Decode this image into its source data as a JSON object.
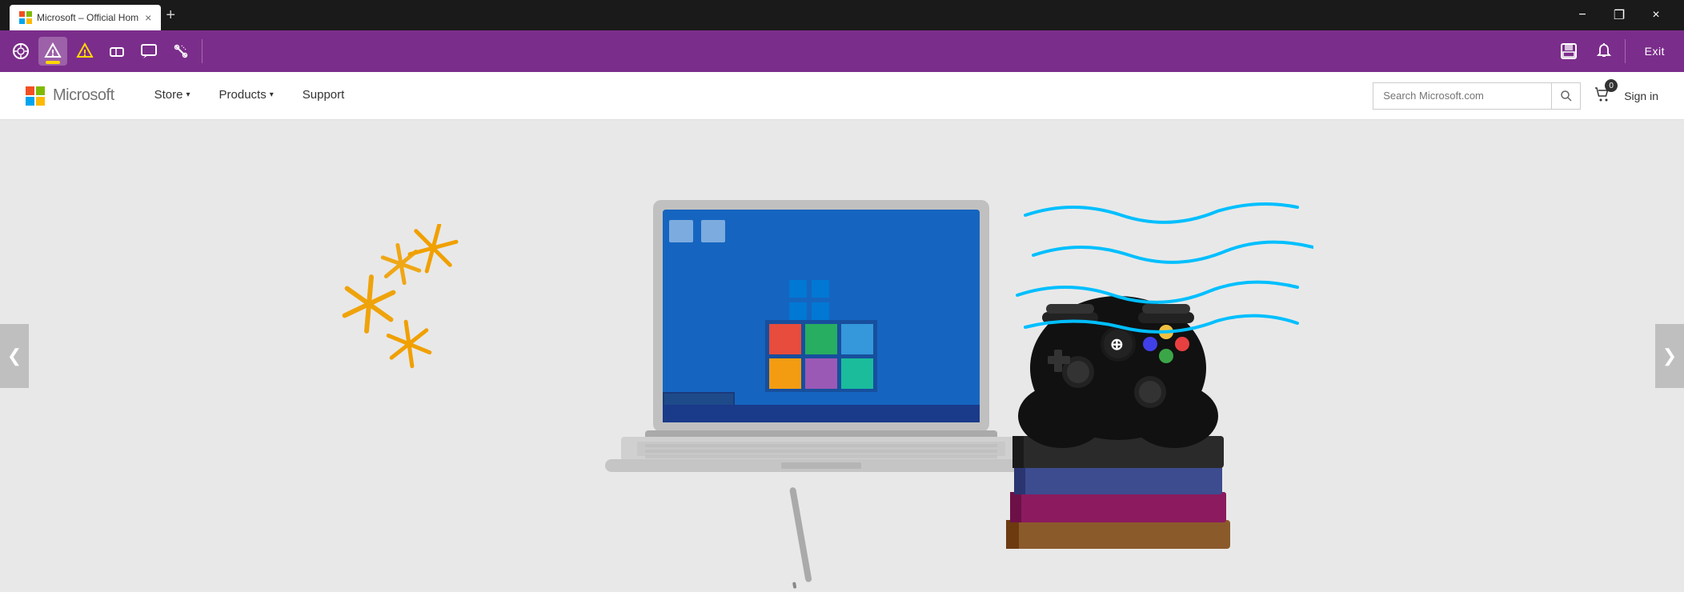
{
  "titlebar": {
    "tab_title": "Microsoft – Official Hom",
    "favicon_alt": "microsoft-favicon",
    "close_label": "×",
    "minimize_label": "−",
    "maximize_label": "❐",
    "new_tab_label": "+"
  },
  "toolbar": {
    "icons": [
      {
        "name": "overview-icon",
        "symbol": "⊙",
        "active": false
      },
      {
        "name": "filter-icon",
        "symbol": "⬡",
        "active": true
      },
      {
        "name": "highlight-icon",
        "symbol": "⬡",
        "active": false
      },
      {
        "name": "erase-icon",
        "symbol": "◇",
        "active": false
      },
      {
        "name": "comment-icon",
        "symbol": "☐",
        "active": false
      },
      {
        "name": "magic-icon",
        "symbol": "✲",
        "active": false
      }
    ],
    "exit_label": "Exit"
  },
  "navbar": {
    "logo_text": "Microsoft",
    "links": [
      {
        "label": "Store",
        "has_dropdown": true
      },
      {
        "label": "Products",
        "has_dropdown": true
      },
      {
        "label": "Support",
        "has_dropdown": false
      }
    ],
    "search": {
      "placeholder": "Search Microsoft.com",
      "button_label": "🔍"
    },
    "cart": {
      "label": "0"
    },
    "signin_label": "Sign in"
  },
  "hero": {
    "arrow_left": "❮",
    "arrow_right": "❯"
  }
}
